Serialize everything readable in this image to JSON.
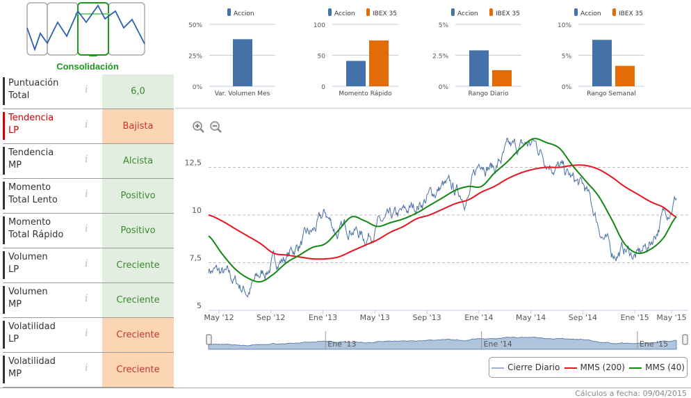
{
  "pattern": {
    "label": "Consolidación"
  },
  "indicators": [
    {
      "label1": "Puntuación",
      "label2": "Total",
      "value": "6,0",
      "status": "good"
    },
    {
      "label1": "Tendencia",
      "label2": "LP",
      "value": "Bajista",
      "status": "bad"
    },
    {
      "label1": "Tendencia",
      "label2": "MP",
      "value": "Alcista",
      "status": "good"
    },
    {
      "label1": "Momento",
      "label2": "Total Lento",
      "value": "Positivo",
      "status": "good"
    },
    {
      "label1": "Momento",
      "label2": "Total Rápido",
      "value": "Positivo",
      "status": "good"
    },
    {
      "label1": "Volumen",
      "label2": "LP",
      "value": "Creciente",
      "status": "good"
    },
    {
      "label1": "Volumen",
      "label2": "MP",
      "value": "Creciente",
      "status": "good"
    },
    {
      "label1": "Volatilidad",
      "label2": "LP",
      "value": "Creciente",
      "status": "bad"
    },
    {
      "label1": "Volatilidad",
      "label2": "MP",
      "value": "Creciente",
      "status": "bad"
    }
  ],
  "colors": {
    "accion": "#4472a8",
    "ibex": "#e36c09",
    "price": "#4a6fa5",
    "mms200": "#e8141e",
    "mms40": "#118811"
  },
  "chart_data": [
    {
      "type": "bar",
      "title": "Var. Volumen Mes",
      "legend": [
        "Accion"
      ],
      "yticks": [
        "0%",
        "25%",
        "50%"
      ],
      "ymax": 50,
      "values": [
        38
      ]
    },
    {
      "type": "bar",
      "title": "Momento Rápido",
      "legend": [
        "Accion",
        "IBEX 35"
      ],
      "yticks": [
        "0",
        "50",
        "100"
      ],
      "ymax": 100,
      "values": [
        41,
        74
      ]
    },
    {
      "type": "bar",
      "title": "Rango Diario",
      "legend": [
        "Accion",
        "IBEX 35"
      ],
      "yticks": [
        "0%",
        "2.5%",
        "5%"
      ],
      "ymax": 5,
      "values": [
        2.9,
        1.3
      ]
    },
    {
      "type": "bar",
      "title": "Rango Semanal",
      "legend": [
        "Accion",
        "IBEX 35"
      ],
      "yticks": [
        "0%",
        "5%",
        "10%"
      ],
      "ymax": 10,
      "values": [
        7.5,
        3.3
      ]
    },
    {
      "type": "line",
      "yticks": [
        "5",
        "7,5",
        "10",
        "12,5"
      ],
      "ylim": [
        5,
        14.5
      ],
      "xticks": [
        "May '12",
        "Sep '12",
        "Ene '13",
        "May '13",
        "Sep '13",
        "Ene '14",
        "May '14",
        "Sep '14",
        "Ene '15",
        "May '15"
      ],
      "navigator_ticks": [
        "Ene '13",
        "Ene '14",
        "Ene '15"
      ],
      "x_months_from_apr_2012": [
        0,
        1,
        2,
        3,
        4,
        5,
        6,
        7,
        8,
        9,
        10,
        11,
        12,
        13,
        14,
        15,
        16,
        17,
        18,
        19,
        20,
        21,
        22,
        23,
        24,
        25,
        26,
        27,
        28,
        29,
        30,
        31,
        32,
        33,
        34,
        35,
        36
      ],
      "series": [
        {
          "name": "Cierre Diario",
          "values": [
            7.2,
            6.9,
            6.5,
            6.0,
            6.8,
            7.5,
            7.8,
            8.5,
            9.0,
            10.0,
            9.0,
            9.5,
            8.8,
            9.5,
            9.6,
            10.0,
            10.5,
            11.0,
            11.5,
            11.2,
            11.0,
            13.0,
            12.5,
            13.3,
            13.5,
            13.8,
            13.0,
            12.5,
            11.8,
            11.3,
            9.5,
            8.0,
            8.2,
            7.8,
            8.5,
            10.0,
            11.0
          ]
        },
        {
          "name": "MMS (200)",
          "values": [
            10.0,
            9.7,
            9.3,
            8.9,
            8.5,
            8.0,
            7.9,
            7.8,
            7.7,
            7.7,
            7.8,
            8.1,
            8.4,
            8.7,
            9.1,
            9.4,
            9.8,
            10.0,
            10.3,
            10.6,
            10.8,
            11.2,
            11.5,
            11.9,
            12.2,
            12.4,
            12.5,
            12.5,
            12.6,
            12.6,
            12.4,
            12.0,
            11.5,
            11.1,
            10.7,
            10.4,
            9.9
          ]
        },
        {
          "name": "MMS (40)",
          "values": [
            8.9,
            8.0,
            7.2,
            6.7,
            6.5,
            6.9,
            7.5,
            7.9,
            8.3,
            8.5,
            9.2,
            9.9,
            9.7,
            9.4,
            9.6,
            9.8,
            10.1,
            10.5,
            10.9,
            11.3,
            11.5,
            11.5,
            12.2,
            12.8,
            13.5,
            14.0,
            13.8,
            13.5,
            12.6,
            11.8,
            11.0,
            9.8,
            8.5,
            8.0,
            8.2,
            8.8,
            9.9
          ]
        }
      ]
    }
  ],
  "legend": [
    "Cierre Diario",
    "MMS (200)",
    "MMS (40)"
  ],
  "footer": "Cálculos a fecha: 09/04/2015"
}
